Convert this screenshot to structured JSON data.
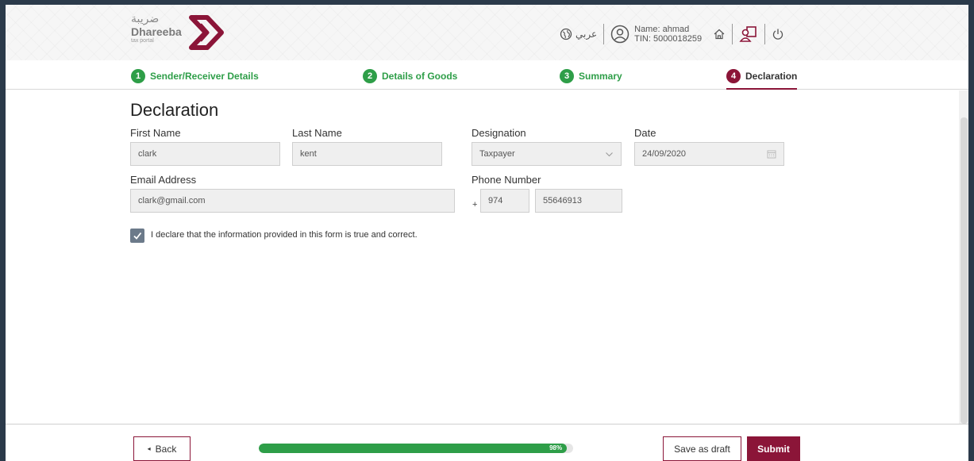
{
  "header": {
    "logo_arabic": "ضريبة",
    "logo_name": "Dhareeba",
    "logo_sub": "tax portal",
    "lang_label": "عربي",
    "user_name": "Name: ahmad",
    "user_tin": "TIN: 5000018259",
    "icons": [
      "globe-icon",
      "user-icon",
      "home-icon",
      "profile-switch-icon",
      "power-icon"
    ]
  },
  "steps": [
    {
      "number": "1",
      "label": "Sender/Receiver Details",
      "state": "done"
    },
    {
      "number": "2",
      "label": "Details of Goods",
      "state": "done"
    },
    {
      "number": "3",
      "label": "Summary",
      "state": "done"
    },
    {
      "number": "4",
      "label": "Declaration",
      "state": "active"
    }
  ],
  "form": {
    "title": "Declaration",
    "first_name_label": "First Name",
    "first_name_value": "clark",
    "last_name_label": "Last Name",
    "last_name_value": "kent",
    "designation_label": "Designation",
    "designation_value": "Taxpayer",
    "date_label": "Date",
    "date_value": "24/09/2020",
    "email_label": "Email Address",
    "email_value": "clark@gmail.com",
    "phone_label": "Phone Number",
    "phone_plus": "+",
    "phone_code": "974",
    "phone_value": "55646913",
    "declaration_checked": true,
    "declaration_text": "I declare that the information provided in this form is true and correct."
  },
  "footer": {
    "back_label": "Back",
    "progress_percent": 98,
    "progress_text": "98%",
    "draft_label": "Save as draft",
    "submit_label": "Submit"
  },
  "colors": {
    "brand": "#8b1538",
    "success": "#2e9e48",
    "input_bg": "#efefef"
  }
}
